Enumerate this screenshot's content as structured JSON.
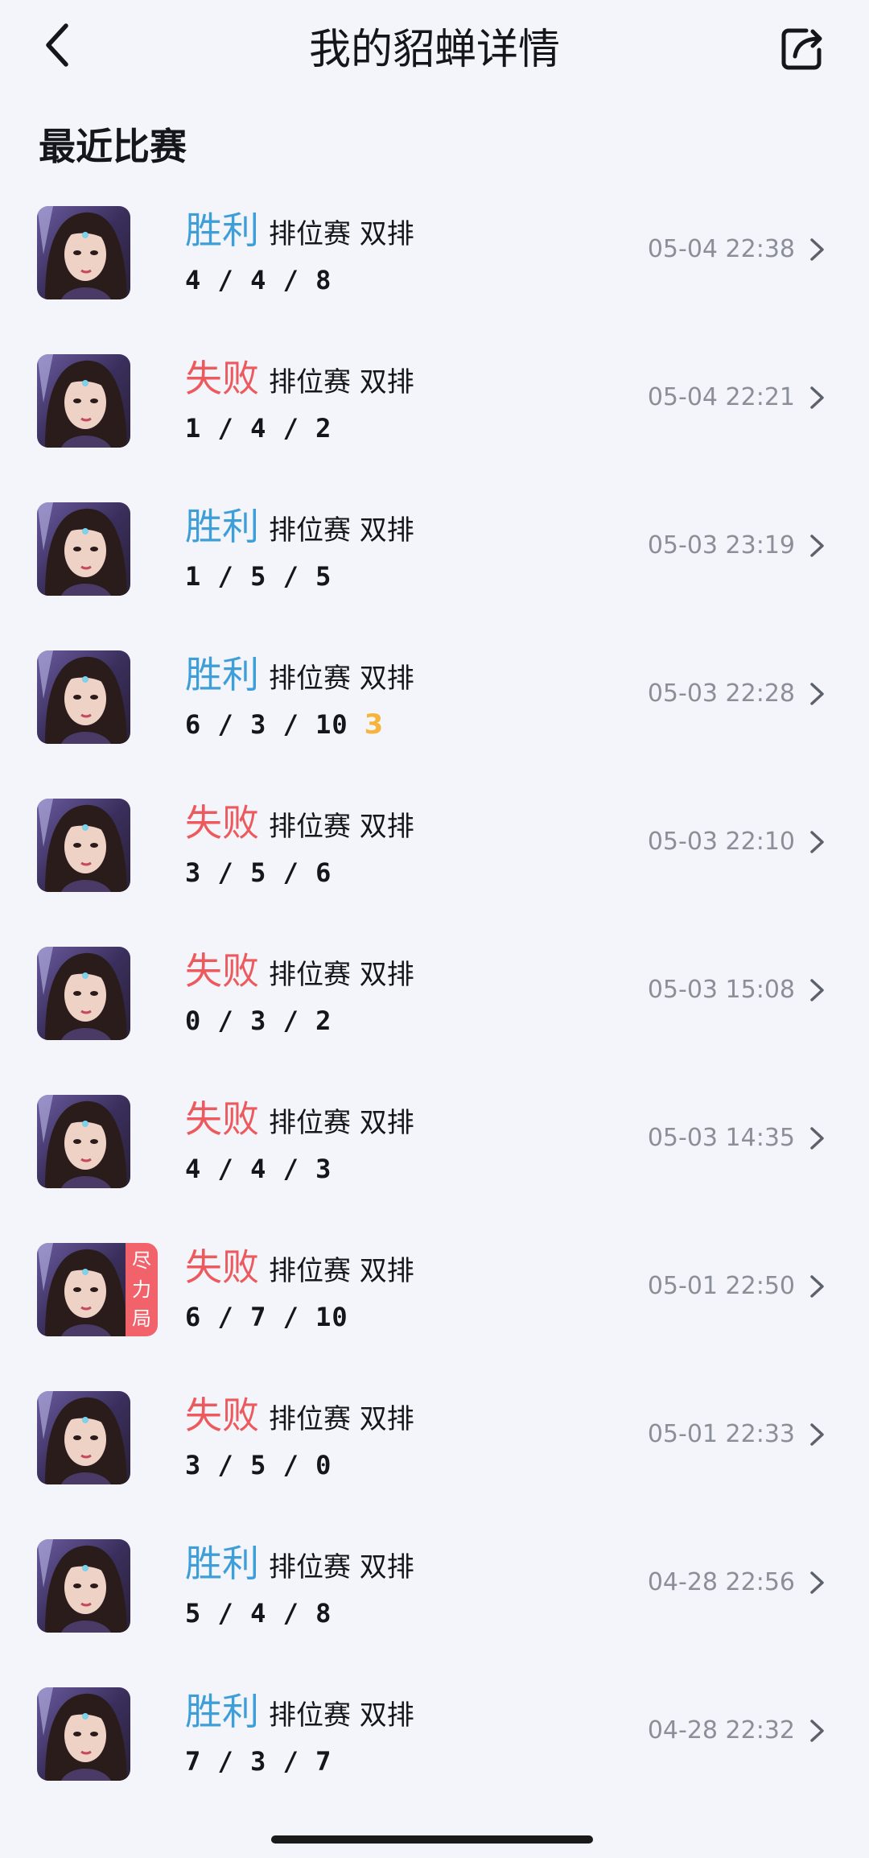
{
  "header": {
    "title": "我的貂蝉详情",
    "back_icon": "chevron-left-icon",
    "share_icon": "share-icon"
  },
  "section": {
    "title": "最近比赛"
  },
  "colors": {
    "win": "#3d9ed8",
    "loss": "#ec5a5e",
    "mvp": "#f6b53a",
    "badge": "#f2626b",
    "background": "#f3f5fa"
  },
  "matches": [
    {
      "result": "胜利",
      "outcome": "win",
      "mode": "排位赛 双排",
      "kda": "4 / 4 / 8",
      "time": "05-04 22:38"
    },
    {
      "result": "失败",
      "outcome": "loss",
      "mode": "排位赛 双排",
      "kda": "1 / 4 / 2",
      "time": "05-04 22:21"
    },
    {
      "result": "胜利",
      "outcome": "win",
      "mode": "排位赛 双排",
      "kda": "1 / 5 / 5",
      "time": "05-03 23:19"
    },
    {
      "result": "胜利",
      "outcome": "win",
      "mode": "排位赛 双排",
      "kda": "6 / 3 / 10",
      "time": "05-03 22:28",
      "mvp": "3"
    },
    {
      "result": "失败",
      "outcome": "loss",
      "mode": "排位赛 双排",
      "kda": "3 / 5 / 6",
      "time": "05-03 22:10"
    },
    {
      "result": "失败",
      "outcome": "loss",
      "mode": "排位赛 双排",
      "kda": "0 / 3 / 2",
      "time": "05-03 15:08"
    },
    {
      "result": "失败",
      "outcome": "loss",
      "mode": "排位赛 双排",
      "kda": "4 / 4 / 3",
      "time": "05-03 14:35"
    },
    {
      "result": "失败",
      "outcome": "loss",
      "mode": "排位赛 双排",
      "kda": "6 / 7 / 10",
      "time": "05-01 22:50",
      "badge": "尽力局"
    },
    {
      "result": "失败",
      "outcome": "loss",
      "mode": "排位赛 双排",
      "kda": "3 / 5 / 0",
      "time": "05-01 22:33"
    },
    {
      "result": "胜利",
      "outcome": "win",
      "mode": "排位赛 双排",
      "kda": "5 / 4 / 8",
      "time": "04-28 22:56"
    },
    {
      "result": "胜利",
      "outcome": "win",
      "mode": "排位赛 双排",
      "kda": "7 / 3 / 7",
      "time": "04-28 22:32"
    }
  ]
}
